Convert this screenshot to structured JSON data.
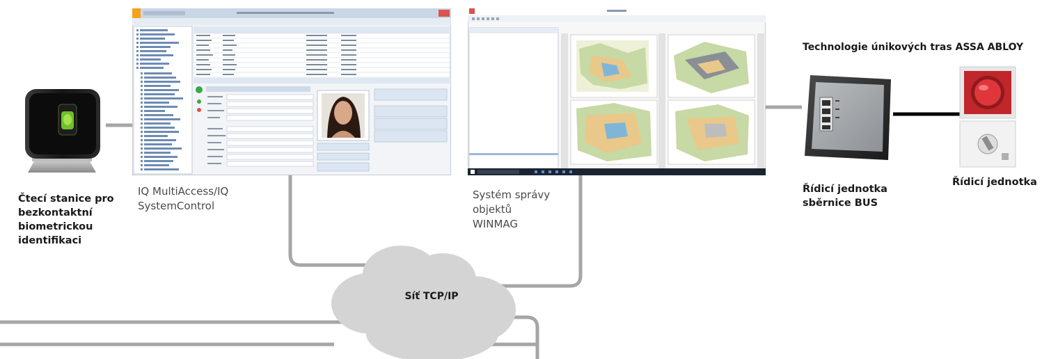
{
  "labels": {
    "biometric_station": [
      "Čtecí stanice pro",
      "bezkontaktní",
      "biometrickou",
      "identifikaci"
    ],
    "iq_software": [
      "IQ MultiAccess/IQ",
      "SystemControl"
    ],
    "winmag": [
      "Systém správy",
      "objektů",
      "WINMAG"
    ],
    "assa_title": "Technologie únikových tras ASSA ABLOY",
    "bus_unit": [
      "Řídicí jednotka",
      "sběrnice BUS"
    ],
    "control_unit": "Řídicí jednotka",
    "network": "Síť TCP/IP"
  },
  "colors": {
    "line": "#a6a6a6",
    "cloud": "#d4d4d4",
    "black_link": "#000000",
    "iq_accent": "#f5a21b",
    "winmag_title": "#1f6fbf",
    "taskbar": "#1c2431"
  }
}
